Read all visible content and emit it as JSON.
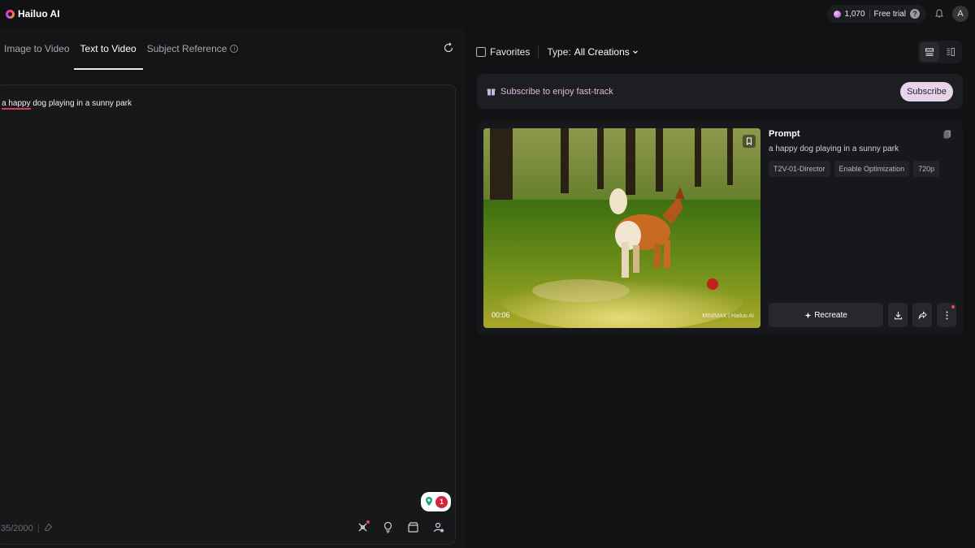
{
  "header": {
    "brand": "Hailuo AI",
    "credits": "1,070",
    "free_trial": "Free trial",
    "help": "?",
    "avatar_initial": "A"
  },
  "left_panel": {
    "tabs": [
      {
        "label": "Image to Video",
        "active": false
      },
      {
        "label": "Text to Video",
        "active": true
      },
      {
        "label": "Subject Reference",
        "active": false
      }
    ],
    "prompt_underlined": "a happy",
    "prompt_rest": " dog playing in a sunny park",
    "char_counter": "35/2000",
    "badge_count": "1"
  },
  "right_panel": {
    "favorites_label": "Favorites",
    "type_label": "Type:",
    "type_value": "All Creations",
    "subscribe_text": "Subscribe to enjoy fast-track",
    "subscribe_button": "Subscribe",
    "card": {
      "duration": "00:06",
      "watermark": "MINIMAX | Hailuo AI",
      "prompt_title": "Prompt",
      "prompt": "a happy dog playing in a sunny park",
      "tags": [
        "T2V-01-Director",
        "Enable Optimization",
        "720p"
      ],
      "recreate_label": "Recreate"
    }
  },
  "colors": {
    "accent_pink": "#e3b7e0",
    "error_underline": "#d43b4f",
    "badge_red": "#d6233d"
  }
}
